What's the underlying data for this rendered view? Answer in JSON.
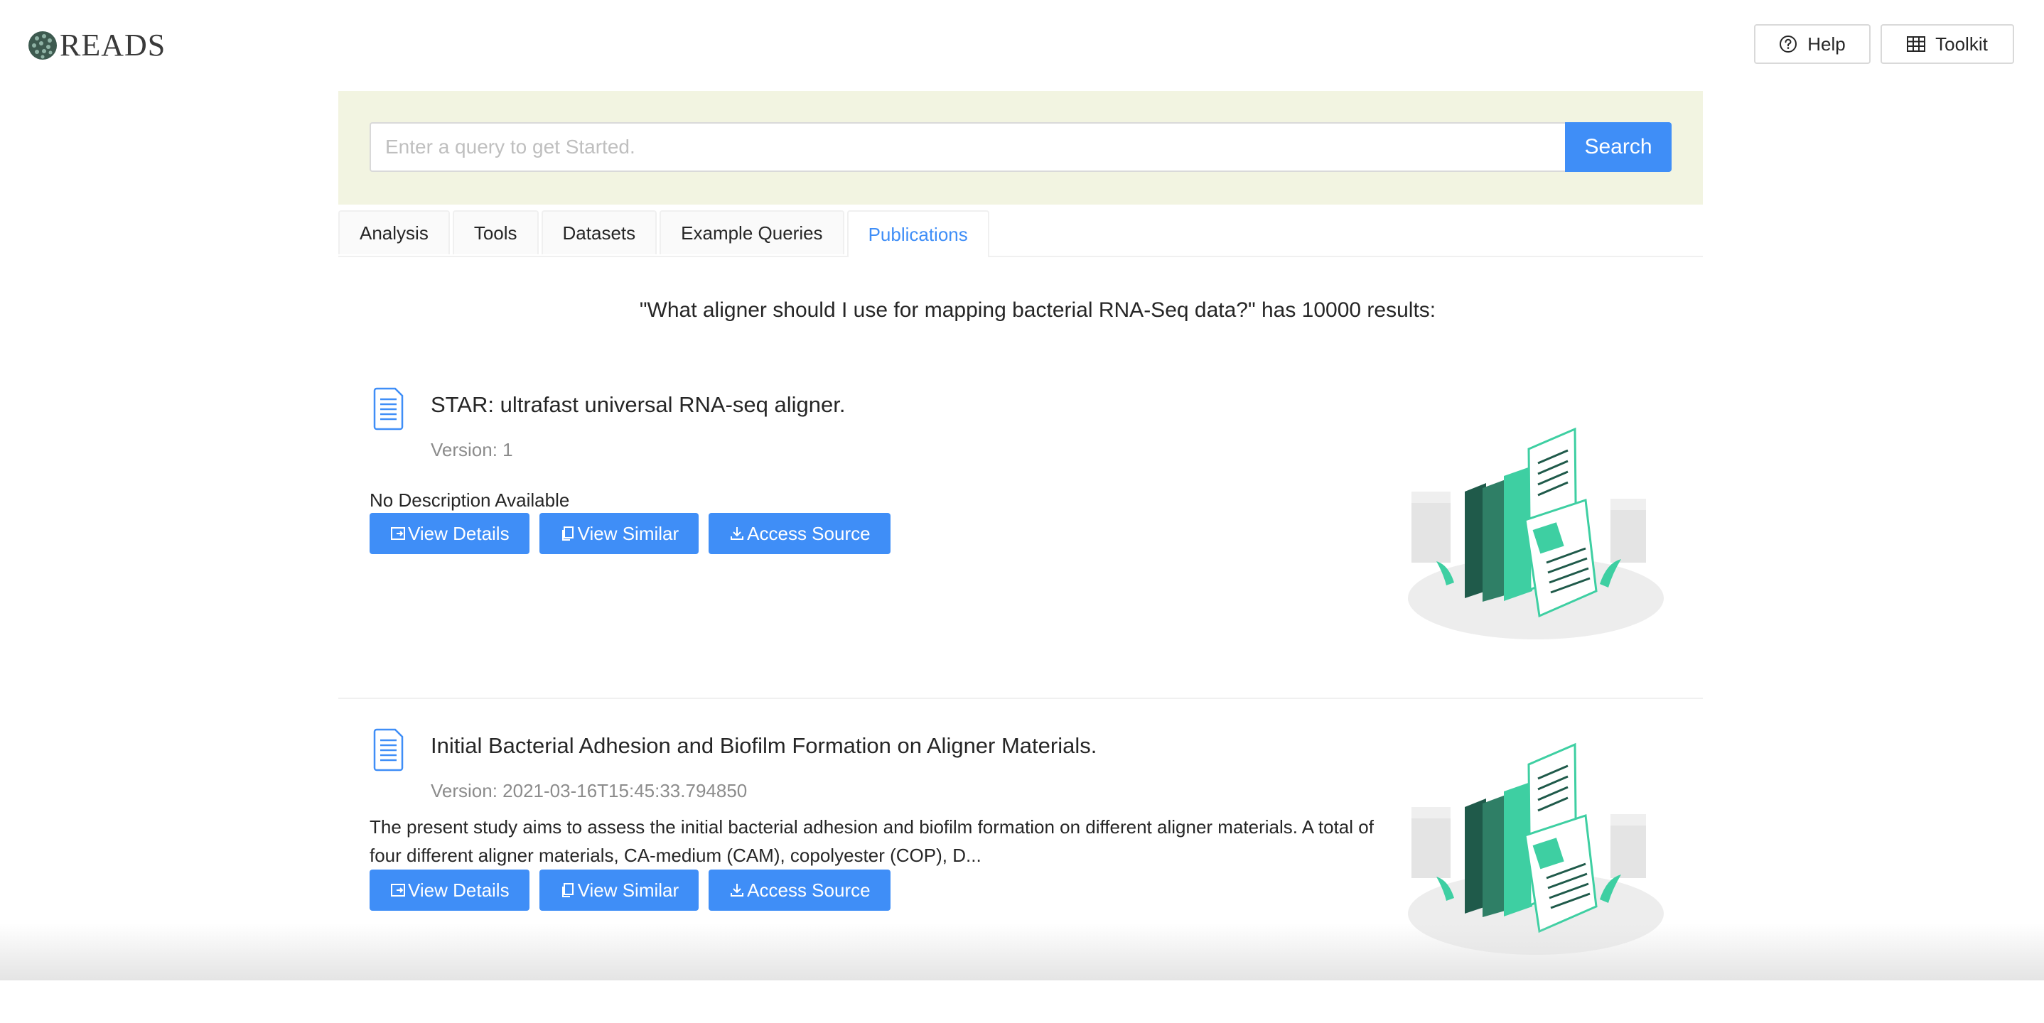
{
  "app": {
    "logo_text": "READS"
  },
  "header": {
    "help_label": "Help",
    "toolkit_label": "Toolkit"
  },
  "search": {
    "placeholder": "Enter a query to get Started.",
    "button_label": "Search"
  },
  "tabs": [
    {
      "label": "Analysis",
      "active": false
    },
    {
      "label": "Tools",
      "active": false
    },
    {
      "label": "Datasets",
      "active": false
    },
    {
      "label": "Example Queries",
      "active": false
    },
    {
      "label": "Publications",
      "active": true
    }
  ],
  "results_heading": "\"What aligner should I use for mapping bacterial RNA-Seq data?\" has 10000 results:",
  "results": [
    {
      "title": "STAR: ultrafast universal RNA-seq aligner.",
      "version": "Version: 1",
      "description": "No Description Available",
      "view_details": "View Details",
      "view_similar": "View Similar",
      "access_source": "Access Source"
    },
    {
      "title": "Initial Bacterial Adhesion and Biofilm Formation on Aligner Materials.",
      "version": "Version: 2021-03-16T15:45:33.794850",
      "description": "The present study aims to assess the initial bacterial adhesion and biofilm formation on different aligner materials. A total of four different aligner materials, CA-medium (CAM), copolyester (COP), D...",
      "view_details": "View Details",
      "view_similar": "View Similar",
      "access_source": "Access Source"
    }
  ],
  "colors": {
    "accent": "#3f8ef7",
    "search_band": "#f2f4e1",
    "illustration_green": "#3ecfa2",
    "illustration_dark": "#1f5a4a"
  },
  "icons": {
    "help": "question-circle-icon",
    "toolkit": "table-icon",
    "result": "document-icon",
    "view_details": "export-icon",
    "view_similar": "copy-icon",
    "access_source": "download-icon"
  }
}
